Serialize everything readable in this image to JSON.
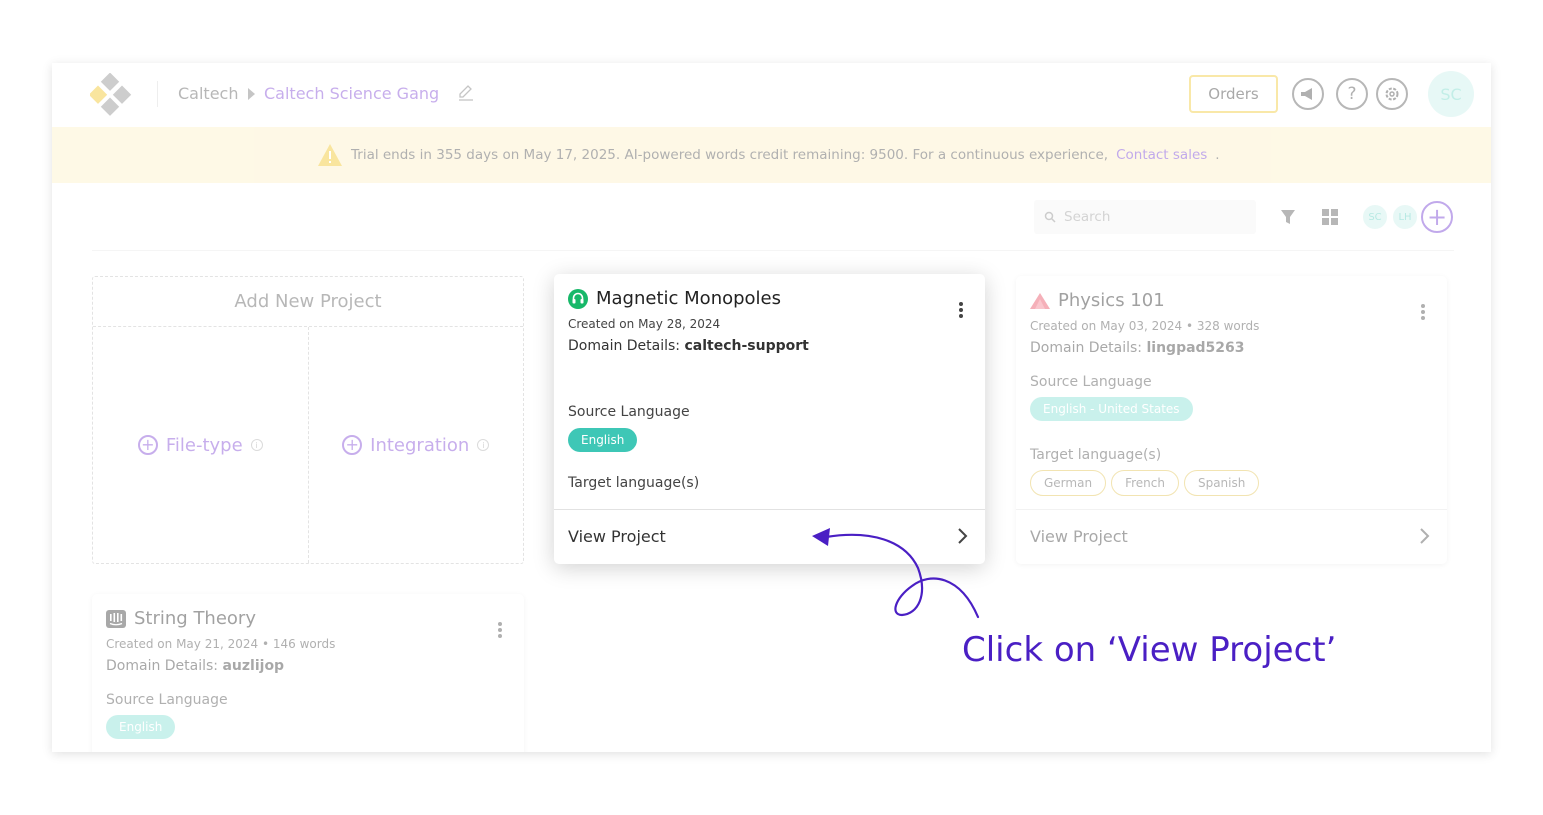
{
  "header": {
    "breadcrumb_root": "Caltech",
    "breadcrumb_current": "Caltech Science Gang",
    "orders_label": "Orders",
    "avatar_initials": "SC",
    "icons": [
      "announcement-icon",
      "help-icon",
      "settings-icon"
    ]
  },
  "banner": {
    "message": "Trial ends in 355 days on May 17, 2025. AI-powered words credit remaining: 9500. For a continuous experience,",
    "link": "Contact sales",
    "suffix": "."
  },
  "toolbar": {
    "search_placeholder": "Search",
    "members": [
      "SC",
      "LH"
    ]
  },
  "new_project": {
    "title": "Add New Project",
    "options": [
      "File-type",
      "Integration"
    ]
  },
  "projects": [
    {
      "title": "Magnetic Monopoles",
      "created": "Created on May 28, 2024",
      "domain_label": "Domain Details:",
      "domain_value": "caltech-support",
      "source_label": "Source Language",
      "source_language": "English",
      "target_label": "Target language(s)",
      "targets": [],
      "view_label": "View Project"
    },
    {
      "title": "Physics 101",
      "created": "Created on May 03, 2024",
      "words": "328 words",
      "domain_label": "Domain Details:",
      "domain_value": "lingpad5263",
      "source_label": "Source Language",
      "source_language": "English - United States",
      "target_label": "Target language(s)",
      "targets": [
        "German",
        "French",
        "Spanish"
      ],
      "view_label": "View Project"
    },
    {
      "title": "String Theory",
      "created": "Created on May 21, 2024",
      "words": "146 words",
      "domain_label": "Domain Details:",
      "domain_value": "auzlijop",
      "source_label": "Source Language",
      "source_language": "English"
    }
  ],
  "annotation": {
    "text": "Click on ‘View Project’"
  },
  "colors": {
    "accent_purple": "#7b3fd3",
    "annotation_purple": "#4a1fc4",
    "teal": "#3ec7b6",
    "banner_bg": "#fdf0c4",
    "orders_border": "#f1c933"
  }
}
